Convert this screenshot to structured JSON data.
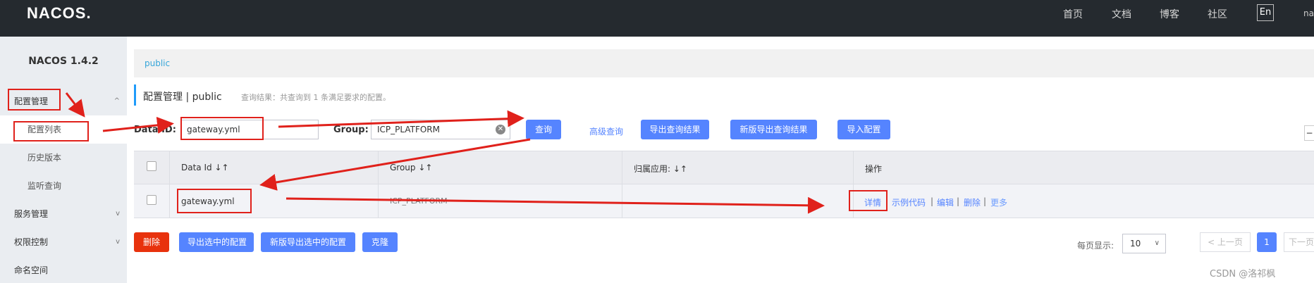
{
  "header": {
    "logo": "NACOS.",
    "nav": [
      "首页",
      "文档",
      "博客",
      "社区"
    ],
    "lang_button": "En",
    "user_cut": "nac"
  },
  "sidebar": {
    "version": "NACOS 1.4.2",
    "items": [
      {
        "label": "配置管理",
        "chevron": "^"
      },
      {
        "label": "配置列表"
      },
      {
        "label": "历史版本"
      },
      {
        "label": "监听查询"
      },
      {
        "label": "服务管理",
        "chevron": "v"
      },
      {
        "label": "权限控制",
        "chevron": "v"
      },
      {
        "label": "命名空间"
      }
    ]
  },
  "namespace_bar": {
    "link": "public"
  },
  "page": {
    "title": "配置管理 | public",
    "result_hint": "查询结果：共查询到 1 条满足要求的配置。"
  },
  "filters": {
    "data_id_label": "Data ID:",
    "data_id_value": "gateway.yml",
    "group_label": "Group:",
    "group_value": "ICP_PLATFORM",
    "query_button": "查询",
    "advanced_query": "高级查询",
    "export_results": "导出查询结果",
    "new_export_results": "新版导出查询结果",
    "import_config": "导入配置"
  },
  "table": {
    "headers": [
      "Data Id ↓↑",
      "Group ↓↑",
      "归属应用: ↓↑",
      "操作"
    ],
    "rows": [
      {
        "data_id": "gateway.yml",
        "group": "ICP_PLATFORM",
        "app": "",
        "actions": [
          "详情",
          "示例代码",
          "编辑",
          "删除",
          "更多"
        ]
      }
    ]
  },
  "bulk": {
    "delete": "删除",
    "export_selected": "导出选中的配置",
    "new_export_selected": "新版导出选中的配置",
    "clone": "克隆"
  },
  "pagination": {
    "page_size_label": "每页显示:",
    "page_size": "10",
    "prev": "< 上一页",
    "current": "1",
    "next": "下一页"
  },
  "watermark": "CSDN @洛祁枫",
  "colors": {
    "primary": "#5584ff",
    "danger": "#e8320d",
    "annotation": "#e0211b",
    "topbar": "#252a2f"
  }
}
